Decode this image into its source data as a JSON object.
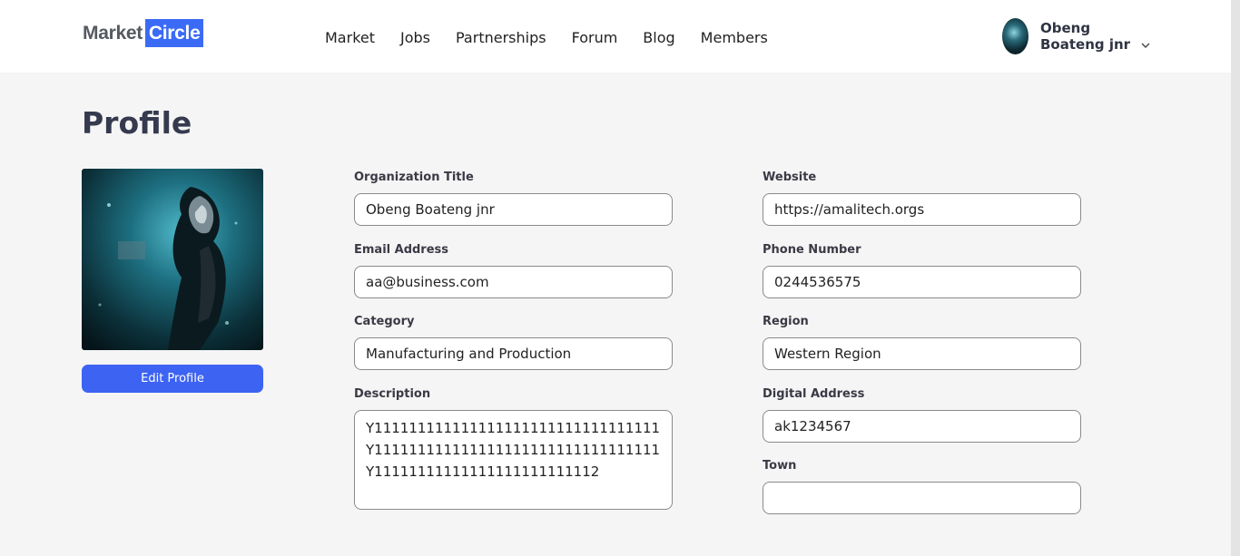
{
  "brand": {
    "part1": "Market",
    "part2": "Circle",
    "accent": "#3b6bf5"
  },
  "nav": {
    "items": [
      "Market",
      "Jobs",
      "Partnerships",
      "Forum",
      "Blog",
      "Members"
    ]
  },
  "user": {
    "name_line1": "Obeng",
    "name_line2": "Boateng jnr",
    "avatar_icon": "avatar-photo",
    "menu_icon": "chevron-down-icon"
  },
  "page": {
    "title": "Profile"
  },
  "profile": {
    "photo_icon": "profile-photo",
    "edit_label": "Edit Profile",
    "button_color": "#3d63f2"
  },
  "fields": {
    "organization_title": {
      "label": "Organization Title",
      "value": "Obeng Boateng jnr"
    },
    "email": {
      "label": "Email Address",
      "value": "aa@business.com"
    },
    "category": {
      "label": "Category",
      "value": "Manufacturing and Production"
    },
    "description": {
      "label": "Description",
      "lines": [
        "Y111111111111111111111111111111111111",
        "Y111111111111111111111111111111111111",
        "Y11111111111111111111111112"
      ]
    },
    "website": {
      "label": "Website",
      "value": "https://amalitech.orgs"
    },
    "phone": {
      "label": "Phone Number",
      "value": "0244536575"
    },
    "region": {
      "label": "Region",
      "value": "Western Region"
    },
    "digital_address": {
      "label": "Digital Address",
      "value": "ak1234567"
    },
    "town": {
      "label": "Town",
      "value": ""
    }
  }
}
